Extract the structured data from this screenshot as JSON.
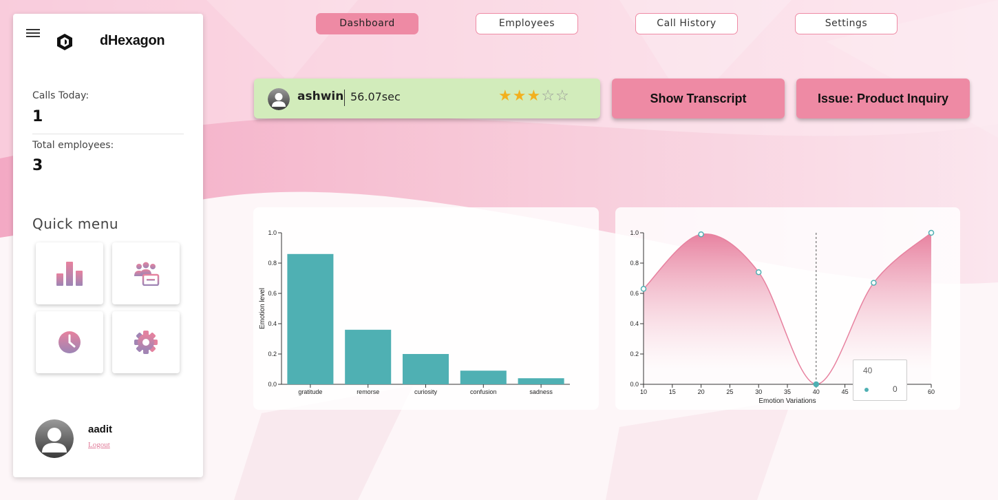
{
  "app": {
    "brand": "dHexagon"
  },
  "nav": {
    "tabs": [
      {
        "label": "Dashboard",
        "active": true
      },
      {
        "label": "Employees",
        "active": false
      },
      {
        "label": "Call History",
        "active": false
      },
      {
        "label": "Settings",
        "active": false
      }
    ]
  },
  "sidebar": {
    "calls_today_label": "Calls Today:",
    "calls_today_value": "1",
    "total_employees_label": "Total employees:",
    "total_employees_value": "3",
    "quick_menu_title": "Quick menu",
    "quick_menu_icons": [
      "bar-chart-icon",
      "team-icon",
      "clock-icon",
      "gear-icon"
    ],
    "user": {
      "name": "aadit",
      "logout_label": "Logout"
    }
  },
  "call": {
    "caller": "ashwin",
    "duration": "56.07sec",
    "rating": 3,
    "rating_max": 5,
    "transcript_button": "Show Transcript",
    "issue_label": "Issue: Product Inquiry"
  },
  "colors": {
    "accent": "#ee8aa4",
    "teal": "#4fb0b3",
    "call_card": "#d2ecbb",
    "star": "#f2b01e"
  },
  "chart_data": [
    {
      "type": "bar",
      "categories": [
        "gratitude",
        "remorse",
        "curiosity",
        "confusion",
        "sadness"
      ],
      "values": [
        0.86,
        0.36,
        0.2,
        0.09,
        0.04
      ],
      "ylabel": "Emotion level",
      "ylim": [
        0,
        1.0
      ],
      "yticks": [
        "0.0",
        "0.2",
        "0.4",
        "0.6",
        "0.8",
        "1.0"
      ]
    },
    {
      "type": "area",
      "x": [
        10,
        20,
        30,
        40,
        50,
        60
      ],
      "values": [
        0.63,
        0.99,
        0.74,
        0.0,
        0.67,
        1.0
      ],
      "xlabel": "Emotion Variations",
      "xlim": [
        10,
        60
      ],
      "ylim": [
        0,
        1.0
      ],
      "xticks": [
        "10",
        "15",
        "20",
        "25",
        "30",
        "35",
        "40",
        "45",
        "50",
        "55",
        "60"
      ],
      "yticks": [
        "0.0",
        "0.2",
        "0.4",
        "0.6",
        "0.8",
        "1.0"
      ],
      "tooltip": {
        "x": "40",
        "value": "0"
      }
    }
  ]
}
